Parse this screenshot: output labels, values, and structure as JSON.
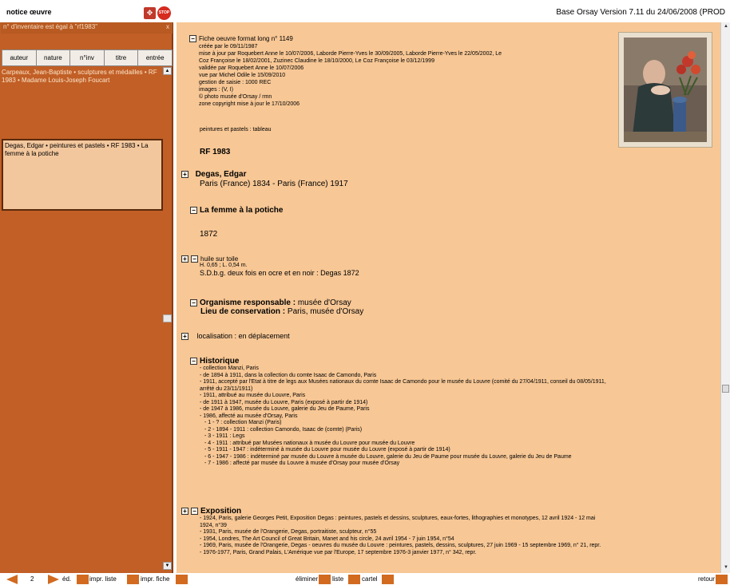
{
  "window": {
    "title": "notice œuvre",
    "version": "Base Orsay Version 7.11 du 24/06/2008 (PROD",
    "stop_label": "STOP",
    "nav_label": "✥"
  },
  "sidebar": {
    "query": "n° d'inventaire est égal à \"rf1983\"",
    "query_close": "x",
    "tabs": [
      "auteur",
      "nature",
      "n°inv",
      "titre",
      "entrée"
    ],
    "results": "Carpeaux, Jean-Baptiste • sculptures et médailles • RF 1983 • Madame Louis-Joseph Foucart",
    "selected": "Degas, Edgar • peintures et pastels • RF 1983 • La femme à la potiche"
  },
  "notice": {
    "header": "Fiche oeuvre format long n° 1149",
    "meta": [
      "créée par  le 09/11/1987",
      "mise à jour par Roquebert Anne le 10/07/2006, Laborde Pierre-Yves le 30/09/2005, Laborde Pierre-Yves le 22/05/2002, Le",
      "Coz Françoise le 18/02/2001, Zuzinec Claudine le 18/10/2000, Le Coz Françoise le 03/12/1999",
      "validée par Roquebert Anne le 10/07/2006",
      "vue par Michel Odile le 15/09/2010",
      "gestion de saisie : 1000 REC",
      "images : (V, I)",
      "© photo musée d'Orsay / rmn",
      "zone copyright mise à jour le 17/10/2006"
    ],
    "categorie": "peintures et pastels : tableau",
    "inventaire": "RF 1983",
    "artiste": "Degas, Edgar",
    "artiste_dates": "Paris (France) 1834 - Paris (France) 1917",
    "titre": "La femme à la potiche",
    "date": "1872",
    "technique": "huile sur toile",
    "dimensions": "H. 0,65 ; L. 0,54 m.",
    "signature": "S.D.b.g. deux fois en ocre et en noir : Degas 1872",
    "organisme_label": "Organisme responsable :",
    "organisme_value": "musée d'Orsay",
    "lieu_label": "Lieu de conservation :",
    "lieu_value": "Paris, musée d'Orsay",
    "localisation": "localisation :  en déplacement",
    "historique_title": "Historique",
    "historique": [
      "- collection Manzi, Paris",
      "- de 1894 à 1911, dans la collection du comte Isaac de Camondo, Paris",
      "- 1911, accepté par l'Etat à titre de legs aux Musées nationaux du comte Isaac de Camondo pour le musée du Louvre (comité du 27/04/1911, conseil du 08/05/1911,",
      "arrêté du 23/11/1911)",
      "- 1911, attribué au musée du Louvre, Paris",
      "- de 1911 à 1947, musée du Louvre, Paris (exposé à partir de 1914)",
      "- de 1947 à 1986, musée du Louvre, galerie du Jeu de Paume, Paris",
      "- 1986, affecté au musée d'Orsay, Paris"
    ],
    "historique_sub": [
      "- 1 - ? : collection Manzi (Paris)",
      "- 2 - 1894 - 1911 : collection Camondo, Isaac de (comte) (Paris)",
      "- 3 - 1911 : Legs",
      "- 4 - 1911 : attribué par Musées nationaux à musée du Louvre pour musée du Louvre",
      "- 5 - 1911 - 1947 : indéterminé à musée du Louvre pour musée du Louvre (exposé à partir de 1914)",
      "- 6 - 1947 - 1986 : indéterminé par musée du Louvre à musée du Louvre, galerie du Jeu de Paume pour musée du Louvre, galerie du Jeu de Paume",
      "- 7 - 1986 : affecté par musée du Louvre à musée d'Orsay pour musée d'Orsay"
    ],
    "exposition_title": "Exposition",
    "exposition": [
      "- 1924, Paris, galerie Georges Petit, Exposition Degas : peintures, pastels et dessins, sculptures, eaux-fortes, lithographies et monotypes, 12 avril 1924 - 12 mai",
      "1924, n°39",
      "- 1931, Paris, musée de l'Orangerie, Degas, portraitiste, sculpteur, n°55",
      "- 1954, Londres, The Art Council of Great Britain, Manet and his circle, 24 avril 1954 - 7 juin 1954, n°54",
      "- 1969, Paris, musée de l'Orangerie, Degas - oeuvres du musée du Louvre : peintures, pastels, dessins, sculptures, 27 juin 1969 - 15 septembre 1969, n° 21, repr.",
      "- 1976-1977, Paris, Grand Palais, L'Amérique vue par l'Europe, 17 septembre 1976-3 janvier 1977, n° 342, repr."
    ]
  },
  "bottombar": {
    "page": "2",
    "ed": "éd.",
    "impr_liste": "impr. liste",
    "impr_fiche": "impr. fiche",
    "eliminer": "éliminer",
    "liste": "liste",
    "cartel": "cartel",
    "retour": "retour"
  },
  "colors": {
    "left_panel": "#c15f26",
    "main_panel": "#f7c795",
    "accent": "#d26a1f"
  }
}
